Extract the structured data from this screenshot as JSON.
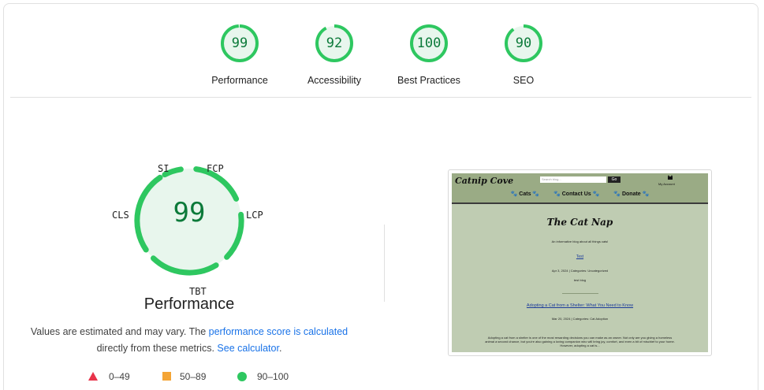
{
  "categories": [
    {
      "score": "99",
      "label": "Performance"
    },
    {
      "score": "92",
      "label": "Accessibility"
    },
    {
      "score": "100",
      "label": "Best Practices"
    },
    {
      "score": "90",
      "label": "SEO"
    }
  ],
  "performance": {
    "score": "99",
    "title": "Performance",
    "metrics": {
      "si": "SI",
      "fcp": "FCP",
      "lcp": "LCP",
      "tbt": "TBT",
      "cls": "CLS"
    },
    "desc_text1": "Values are estimated and may vary. The ",
    "desc_link1": "performance score is calculated",
    "desc_text2": "directly from these metrics. ",
    "desc_link2": "See calculator",
    "desc_text3": "."
  },
  "legend": {
    "fail": "0–49",
    "average": "50–89",
    "pass": "90–100"
  },
  "colors": {
    "pass": "#2ec760",
    "pass_text": "#0c7a3a",
    "average": "#f4a536",
    "fail": "#e8334a",
    "link": "#1a73e8"
  },
  "preview": {
    "logo": "Catnip Cove",
    "search_placeholder": "Search blog...",
    "search_button": "Go",
    "account_label": "My Account",
    "nav": [
      "🐾 Cats 🐾",
      "🐾 Contact Us 🐾",
      "🐾 Donate 🐾"
    ],
    "blog_title": "The Cat Nap",
    "blog_subtitle": "An informative blog about all things cats!",
    "post1_title": "Test",
    "post1_meta": "Apr 3, 2024 | Categories: Uncategorized",
    "post1_body": "test blog",
    "post2_title": "Adopting a Cat from a Shelter: What You Need to Know",
    "post2_meta": "Mar 20, 2024 | Categories: Cat Adoption",
    "post2_excerpt": "Adopting a cat from a shelter is one of the most rewarding decisions you can make as an owner. Not only are you giving a homeless animal a second chance, but you're also gaining a loving companion who will bring joy, comfort, and even a bit of mischief to your home. However, adopting a cat is..."
  }
}
